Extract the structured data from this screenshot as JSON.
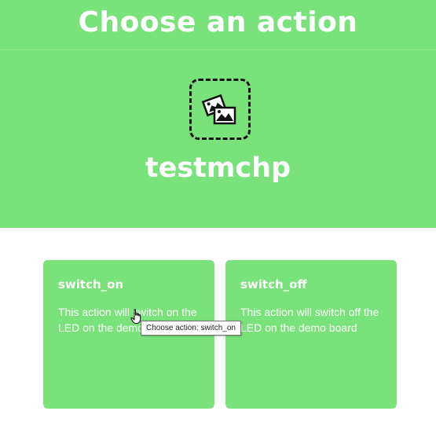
{
  "header": {
    "title": "Choose an action",
    "service_name": "testmchp",
    "service_icon": "image-placeholder-icon",
    "background_color": "#7ae27a"
  },
  "actions": [
    {
      "title": "switch_on",
      "description": "This action will switch on the LED on the demo board"
    },
    {
      "title": "switch_off",
      "description": "This action will switch off the LED on the demo board"
    }
  ],
  "tooltip": {
    "text": "Choose action: switch_on"
  },
  "cursor": {
    "icon": "hand-pointer-icon"
  }
}
